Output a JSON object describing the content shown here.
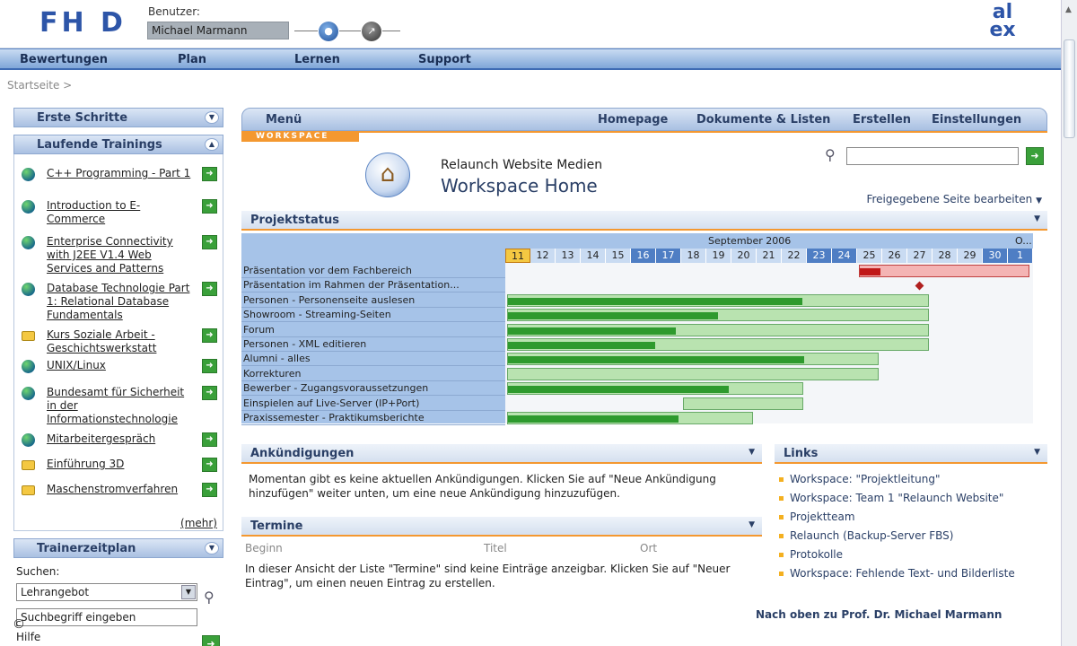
{
  "header": {
    "logo": "FH D",
    "user_label": "Benutzer:",
    "user_value": "Michael Marmann",
    "alex_logo_line1": "al",
    "alex_logo_line2": "ex"
  },
  "nav": [
    "Bewertungen",
    "Plan",
    "Lernen",
    "Support"
  ],
  "breadcrumb": "Startseite >",
  "sidebar": {
    "erste_schritte": "Erste Schritte",
    "laufende_trainings": "Laufende Trainings",
    "trainings": [
      {
        "label": "C++ Programming - Part 1",
        "icon": "globe"
      },
      {
        "label": "Introduction to E-Commerce",
        "icon": "globe"
      },
      {
        "label": "Enterprise Connectivity with J2EE V1.4 Web Services and Patterns",
        "icon": "globe"
      },
      {
        "label": "Database Technologie Part 1: Relational Database Fundamentals",
        "icon": "globe"
      },
      {
        "label": "Kurs Soziale Arbeit - Geschichtswerkstatt",
        "icon": "folder"
      },
      {
        "label": "UNIX/Linux",
        "icon": "globe"
      },
      {
        "label": "Bundesamt für Sicherheit in der Informationstechnologie",
        "icon": "globe"
      },
      {
        "label": "Mitarbeitergespräch",
        "icon": "globe"
      },
      {
        "label": "Einführung 3D",
        "icon": "folder"
      },
      {
        "label": "Maschenstromverfahren",
        "icon": "folder"
      }
    ],
    "more": "(mehr)",
    "trainerzeitplan": "Trainerzeitplan",
    "search_label": "Suchen:",
    "select_value": "Lehrangebot",
    "search_term": "Suchbegriff eingeben",
    "help": "Hilfe",
    "copyright": "©"
  },
  "main": {
    "menu_label": "Menü",
    "menu_items": [
      "Homepage",
      "Dokumente & Listen",
      "Erstellen",
      "Einstellungen"
    ],
    "workspace_tab": "WORKSPACE",
    "ws_subtitle": "Relaunch Website Medien",
    "ws_title": "Workspace Home",
    "edit_page": "Freigegebene Seite bearbeiten",
    "projektstatus": "Projektstatus",
    "ankuendigungen": "Ankündigungen",
    "ankuendigungen_text": "Momentan gibt es keine aktuellen Ankündigungen. Klicken Sie auf \"Neue Ankündigung hinzufügen\" weiter unten, um eine neue Ankündigung hinzuzufügen.",
    "termine": "Termine",
    "termine_cols": [
      "Beginn",
      "Titel",
      "Ort"
    ],
    "termine_text": "In dieser Ansicht der Liste \"Termine\" sind keine Einträge anzeigbar. Klicken Sie auf \"Neuer Eintrag\", um einen neuen Eintrag zu erstellen.",
    "links_title": "Links",
    "links": [
      "Workspace: \"Projektleitung\"",
      "Workspace: Team 1 \"Relaunch Website\"",
      "Projektteam",
      "Relaunch (Backup-Server FBS)",
      "Protokolle",
      "Workspace: Fehlende Text- und Bilderliste"
    ],
    "back_to_top": "Nach oben zu Prof. Dr. Michael Marmann"
  },
  "gantt": {
    "month": "September 2006",
    "next_month": "O...",
    "days": [
      "11",
      "12",
      "13",
      "14",
      "15",
      "16",
      "17",
      "18",
      "19",
      "20",
      "21",
      "22",
      "23",
      "24",
      "25",
      "26",
      "27",
      "28",
      "29",
      "30",
      "1"
    ],
    "weekend_days": [
      "16",
      "17",
      "23",
      "24",
      "30",
      "1"
    ],
    "today": "11",
    "tasks": [
      {
        "name": "Präsentation vor dem Fachbereich",
        "start": "25",
        "end": "1",
        "progress": 0.12,
        "color": "red"
      },
      {
        "name": "Präsentation im Rahmen der Präsentation...",
        "milestone": "27"
      },
      {
        "name": "Personen - Personenseite auslesen",
        "start": "11",
        "end": "27",
        "progress": 0.7
      },
      {
        "name": "Showroom - Streaming-Seiten",
        "start": "11",
        "end": "27",
        "progress": 0.5
      },
      {
        "name": "Forum",
        "start": "11",
        "end": "27",
        "progress": 0.4
      },
      {
        "name": "Personen - XML editieren",
        "start": "11",
        "end": "27",
        "progress": 0.35
      },
      {
        "name": "Alumni - alles",
        "start": "11",
        "end": "25",
        "progress": 0.8
      },
      {
        "name": "Korrekturen",
        "start": "11",
        "end": "25",
        "progress": 0.0
      },
      {
        "name": "Bewerber - Zugangsvoraussetzungen",
        "start": "11",
        "end": "22",
        "progress": 0.75
      },
      {
        "name": "Einspielen auf Live-Server (IP+Port)",
        "start": "18",
        "end": "22",
        "progress": 0.0
      },
      {
        "name": "Praxissemester - Praktikumsberichte",
        "start": "11",
        "end": "20",
        "progress": 0.7
      }
    ]
  }
}
